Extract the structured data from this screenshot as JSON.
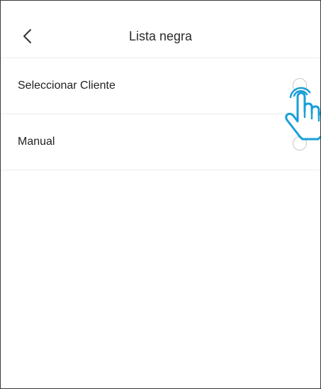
{
  "header": {
    "title": "Lista negra",
    "back_icon": "chevron-left-icon"
  },
  "options": [
    {
      "label": "Seleccionar Cliente",
      "selected": false
    },
    {
      "label": "Manual",
      "selected": false
    }
  ],
  "overlay": {
    "icon": "pointing-hand-icon",
    "color": "#1a9fd8"
  },
  "colors": {
    "divider": "#ececec",
    "text": "#222222",
    "radio_border": "#c8c8c8"
  }
}
